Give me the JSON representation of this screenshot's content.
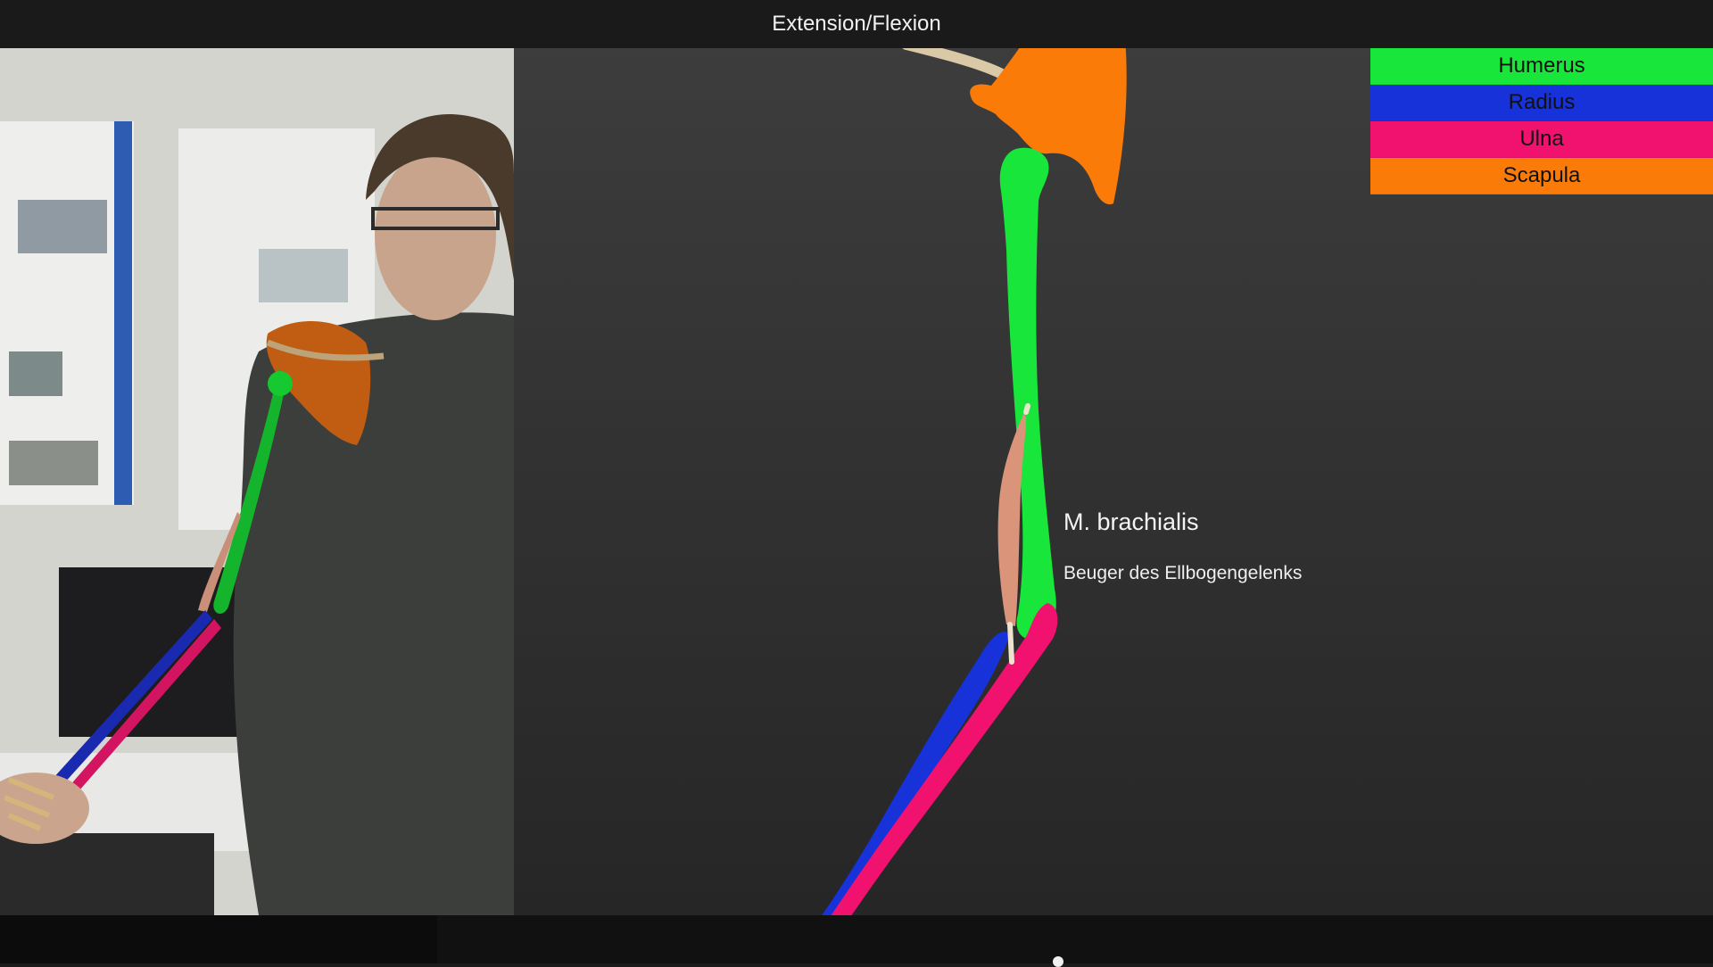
{
  "header": {
    "title": "Extension/Flexion"
  },
  "legend": {
    "items": [
      {
        "label": "Humerus",
        "color": "#19e63a"
      },
      {
        "label": "Radius",
        "color": "#1632d8"
      },
      {
        "label": "Ulna",
        "color": "#f0126e"
      },
      {
        "label": "Scapula",
        "color": "#fb7b08"
      }
    ]
  },
  "annotation": {
    "title": "M. brachialis",
    "subtitle": "Beuger des Ellbogengelenks"
  },
  "colors": {
    "humerus": "#19e63a",
    "radius": "#1632d8",
    "ulna": "#f0126e",
    "scapula": "#fb7b08",
    "muscle": "#d9947a"
  }
}
